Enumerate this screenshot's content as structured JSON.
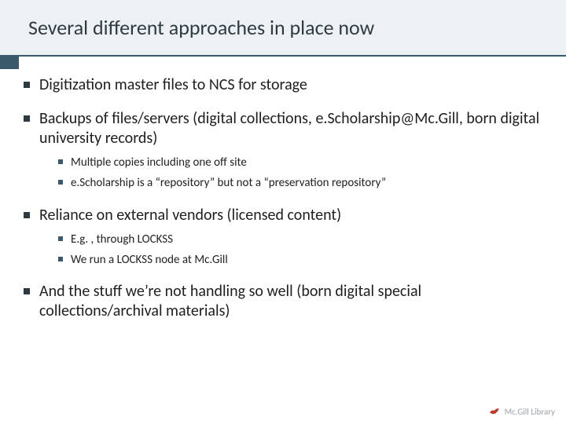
{
  "title": "Several different approaches in place now",
  "bullets": {
    "b0": {
      "text": "Digitization master files to NCS for storage"
    },
    "b1": {
      "text": "Backups of files/servers (digital collections, e.Scholarship@Mc.Gill, born digital university records)",
      "sub": {
        "s0": "Multiple copies including one off site",
        "s1": "e.Scholarship is a “repository” but not a “preservation repository”"
      }
    },
    "b2": {
      "text": "Reliance on external vendors (licensed content)",
      "sub": {
        "s0": "E.g. , through LOCKSS",
        "s1": "We run a LOCKSS node at Mc.Gill"
      }
    },
    "b3": {
      "text": "And the stuff we’re not handling so well (born digital special collections/archival materials)"
    }
  },
  "footer": {
    "brand": "Mc.Gill Library"
  }
}
